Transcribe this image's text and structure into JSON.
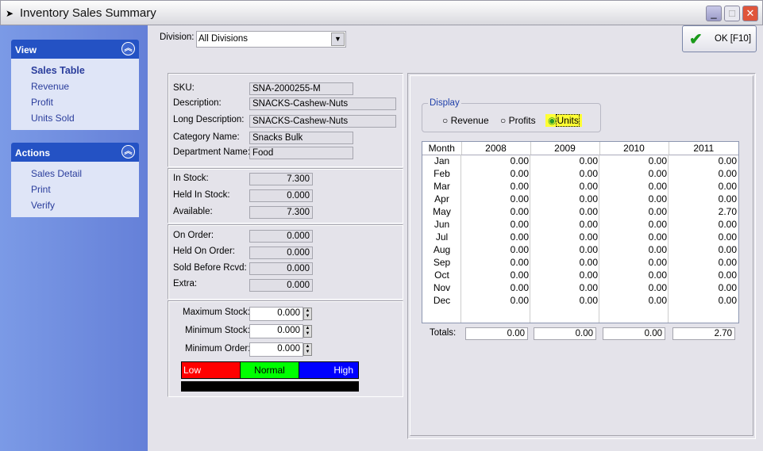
{
  "window": {
    "title": "Inventory Sales Summary",
    "minimize": "_",
    "maximize": "□",
    "close": "✕"
  },
  "sidebar": {
    "view": {
      "title": "View",
      "items": [
        "Sales Table",
        "Revenue",
        "Profit",
        "Units Sold"
      ]
    },
    "actions": {
      "title": "Actions",
      "items": [
        "Sales Detail",
        "Print",
        "Verify"
      ]
    }
  },
  "division": {
    "label": "Division:",
    "value": "All Divisions"
  },
  "ok_button": "OK [F10]",
  "item": {
    "sku_label": "SKU:",
    "sku": "SNA-2000255-M",
    "desc_label": "Description:",
    "desc": "SNACKS-Cashew-Nuts",
    "long_label": "Long Description:",
    "long": "SNACKS-Cashew-Nuts",
    "cat_label": "Category Name:",
    "cat": "Snacks Bulk",
    "dept_label": "Department Name:",
    "dept": "Food"
  },
  "stock": {
    "in_label": "In Stock:",
    "in": "7.300",
    "held_label": "Held In Stock:",
    "held": "0.000",
    "avail_label": "Available:",
    "avail": "7.300"
  },
  "orders": {
    "on_label": "On Order:",
    "on": "0.000",
    "held_label": "Held On Order:",
    "held": "0.000",
    "sold_label": "Sold Before Rcvd:",
    "sold": "0.000",
    "extra_label": "Extra:",
    "extra": "0.000"
  },
  "limits": {
    "max_label": "Maximum Stock:",
    "max": "0.000",
    "min_label": "Minimum Stock:",
    "min": "0.000",
    "order_label": "Minimum Order:",
    "order": "0.000"
  },
  "levels": {
    "low": "Low",
    "normal": "Normal",
    "high": "High",
    "low_color": "#ff0000",
    "normal_color": "#00ff00",
    "high_color": "#0000ff"
  },
  "display": {
    "legend": "Display",
    "options": [
      "Revenue",
      "Profits",
      "Units"
    ],
    "selected": "Units"
  },
  "table": {
    "headers": [
      "Month",
      "2008",
      "2009",
      "2010",
      "2011"
    ],
    "rows": [
      [
        "Jan",
        "0.00",
        "0.00",
        "0.00",
        "0.00"
      ],
      [
        "Feb",
        "0.00",
        "0.00",
        "0.00",
        "0.00"
      ],
      [
        "Mar",
        "0.00",
        "0.00",
        "0.00",
        "0.00"
      ],
      [
        "Apr",
        "0.00",
        "0.00",
        "0.00",
        "0.00"
      ],
      [
        "May",
        "0.00",
        "0.00",
        "0.00",
        "2.70"
      ],
      [
        "Jun",
        "0.00",
        "0.00",
        "0.00",
        "0.00"
      ],
      [
        "Jul",
        "0.00",
        "0.00",
        "0.00",
        "0.00"
      ],
      [
        "Aug",
        "0.00",
        "0.00",
        "0.00",
        "0.00"
      ],
      [
        "Sep",
        "0.00",
        "0.00",
        "0.00",
        "0.00"
      ],
      [
        "Oct",
        "0.00",
        "0.00",
        "0.00",
        "0.00"
      ],
      [
        "Nov",
        "0.00",
        "0.00",
        "0.00",
        "0.00"
      ],
      [
        "Dec",
        "0.00",
        "0.00",
        "0.00",
        "0.00"
      ]
    ],
    "totals_label": "Totals:",
    "totals": [
      "0.00",
      "0.00",
      "0.00",
      "2.70"
    ]
  }
}
